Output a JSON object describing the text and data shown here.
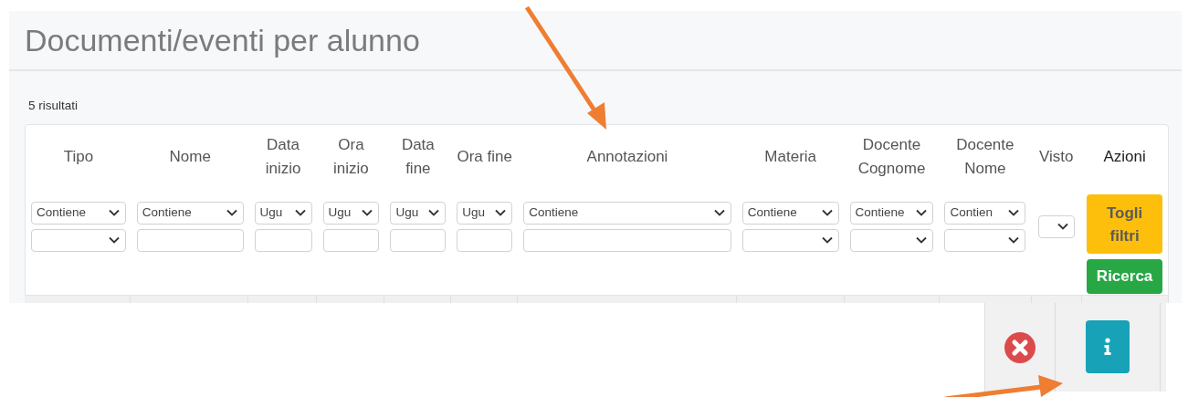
{
  "title": "Documenti/eventi per alunno",
  "result_count": "5 risultati",
  "columns": [
    {
      "header": "Tipo",
      "filters": [
        {
          "kind": "select",
          "value": "Contiene"
        },
        {
          "kind": "select"
        }
      ]
    },
    {
      "header": "Nome",
      "filters": [
        {
          "kind": "select",
          "value": "Contiene"
        },
        {
          "kind": "input"
        }
      ]
    },
    {
      "header": "Data inizio",
      "filters": [
        {
          "kind": "select",
          "value": "Ugu"
        },
        {
          "kind": "input"
        }
      ]
    },
    {
      "header": "Ora inizio",
      "filters": [
        {
          "kind": "select",
          "value": "Ugu"
        },
        {
          "kind": "input"
        }
      ]
    },
    {
      "header": "Data fine",
      "filters": [
        {
          "kind": "select",
          "value": "Ugu"
        },
        {
          "kind": "input"
        }
      ]
    },
    {
      "header": "Ora fine",
      "filters": [
        {
          "kind": "select",
          "value": "Ugu"
        },
        {
          "kind": "input"
        }
      ]
    },
    {
      "header": "Annotazioni",
      "filters": [
        {
          "kind": "select",
          "value": "Contiene"
        },
        {
          "kind": "input"
        }
      ]
    },
    {
      "header": "Materia",
      "filters": [
        {
          "kind": "select",
          "value": "Contiene"
        },
        {
          "kind": "select"
        }
      ]
    },
    {
      "header": "Docente Cognome",
      "filters": [
        {
          "kind": "select",
          "value": "Contiene"
        },
        {
          "kind": "select"
        }
      ]
    },
    {
      "header": "Docente Nome",
      "filters": [
        {
          "kind": "select",
          "value": "Contien"
        },
        {
          "kind": "select"
        }
      ]
    },
    {
      "header": "Visto",
      "filters": [
        {
          "kind": "select"
        }
      ]
    }
  ],
  "actions": {
    "header": "Azioni",
    "buttons": [
      {
        "label": "Togli filtri",
        "kind": "warning"
      },
      {
        "label": "Ricerca",
        "kind": "success"
      }
    ]
  },
  "row_actions": [
    {
      "kind": "delete"
    },
    {
      "kind": "info"
    }
  ]
}
